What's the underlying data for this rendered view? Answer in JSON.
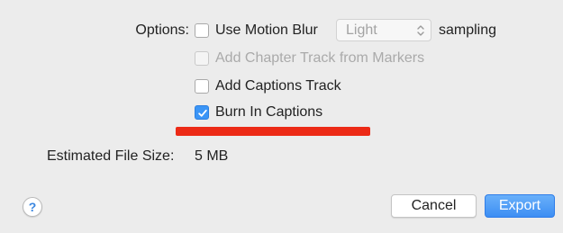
{
  "options": {
    "label": "Options:",
    "use_motion_blur": {
      "label": "Use Motion Blur",
      "checked": false
    },
    "sampling_select": {
      "value": "Light",
      "icon": "up-down-chevron-icon"
    },
    "sampling_label": "sampling",
    "add_chapter_track": {
      "label": "Add Chapter Track from Markers",
      "checked": false,
      "disabled": true
    },
    "add_captions_track": {
      "label": "Add Captions Track",
      "checked": false
    },
    "burn_in_captions": {
      "label": "Burn In Captions",
      "checked": true
    }
  },
  "annotation": {
    "color": "#ec2a16"
  },
  "file_size": {
    "label": "Estimated File Size:",
    "value": "5 MB"
  },
  "footer": {
    "help_label": "?",
    "cancel_label": "Cancel",
    "export_label": "Export"
  },
  "colors": {
    "accent": "#3b95f6",
    "background": "#ececec"
  }
}
